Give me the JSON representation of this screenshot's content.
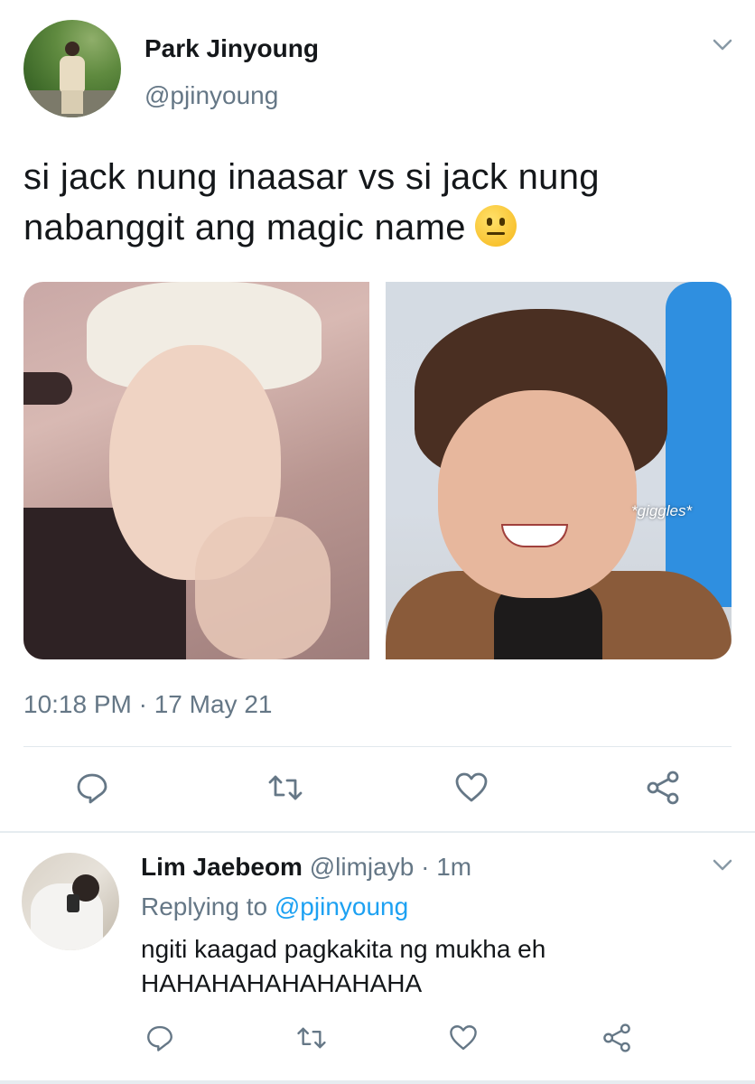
{
  "tweet": {
    "author_name": "Park Jinyoung",
    "author_handle": "@pjinyoung",
    "text": "si jack nung inaasar vs si jack nung nabanggit ang magic name",
    "emoji": "neutral-face-emoji",
    "image_overlay_text": "*giggles*",
    "timestamp": "10:18 PM · 17 May 21",
    "actions": [
      "reply-icon",
      "retweet-icon",
      "like-icon",
      "share-icon"
    ]
  },
  "reply": {
    "author_name": "Lim Jaebeom",
    "author_handle": "@limjayb",
    "separator": "·",
    "time_ago": "1m",
    "replying_label": "Replying to",
    "replying_mention": "@pjinyoung",
    "text_line1": "ngiti kaagad pagkakita ng mukha eh",
    "text_line2": "HAHAHAHAHAHAHAHA",
    "actions": [
      "reply-icon",
      "retweet-icon",
      "like-icon",
      "share-icon"
    ]
  },
  "colors": {
    "text": "#14171a",
    "secondary": "#657786",
    "link": "#1da1f2",
    "divider": "#e1e8ed"
  }
}
